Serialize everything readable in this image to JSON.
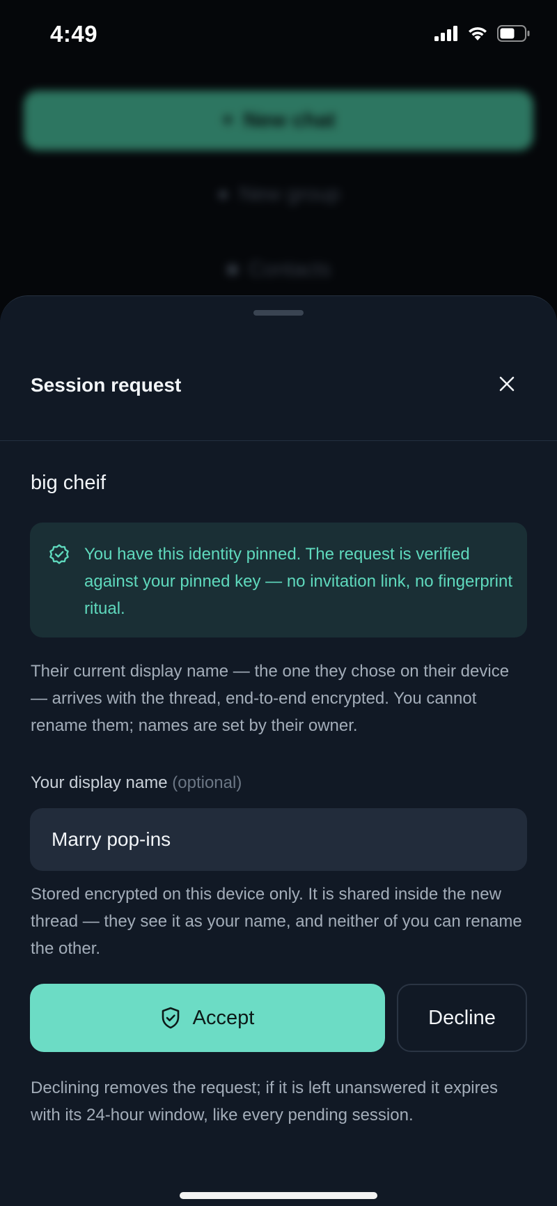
{
  "status_bar": {
    "time": "4:49"
  },
  "background": {
    "new_chat_label": "New chat",
    "new_group_label": "New group",
    "contacts_label": "Contacts"
  },
  "sheet": {
    "title": "Session request",
    "peer_name": "big cheif",
    "verified_notice": "You have this identity pinned. The request is verified against your pinned key — no invitation link, no fingerprint ritual.",
    "display_name_info": "Their current display name — the one they chose on their device — arrives with the thread, end-to-end encrypted. You cannot rename them; names are set by their owner.",
    "field_label": "Your display name",
    "field_optional": "(optional)",
    "display_name_value": "Marry pop-ins",
    "storage_info": "Stored encrypted on this device only. It is shared inside the new thread — they see it as your name, and neither of you can rename the other.",
    "accept_label": "Accept",
    "decline_label": "Decline",
    "decline_info": "Declining removes the request; if it is left unanswered it expires with its 24-hour window, like every pending session."
  },
  "colors": {
    "accent": "#6cdcc5",
    "verified_text": "#5fd9bd",
    "sheet_bg": "#111925"
  }
}
